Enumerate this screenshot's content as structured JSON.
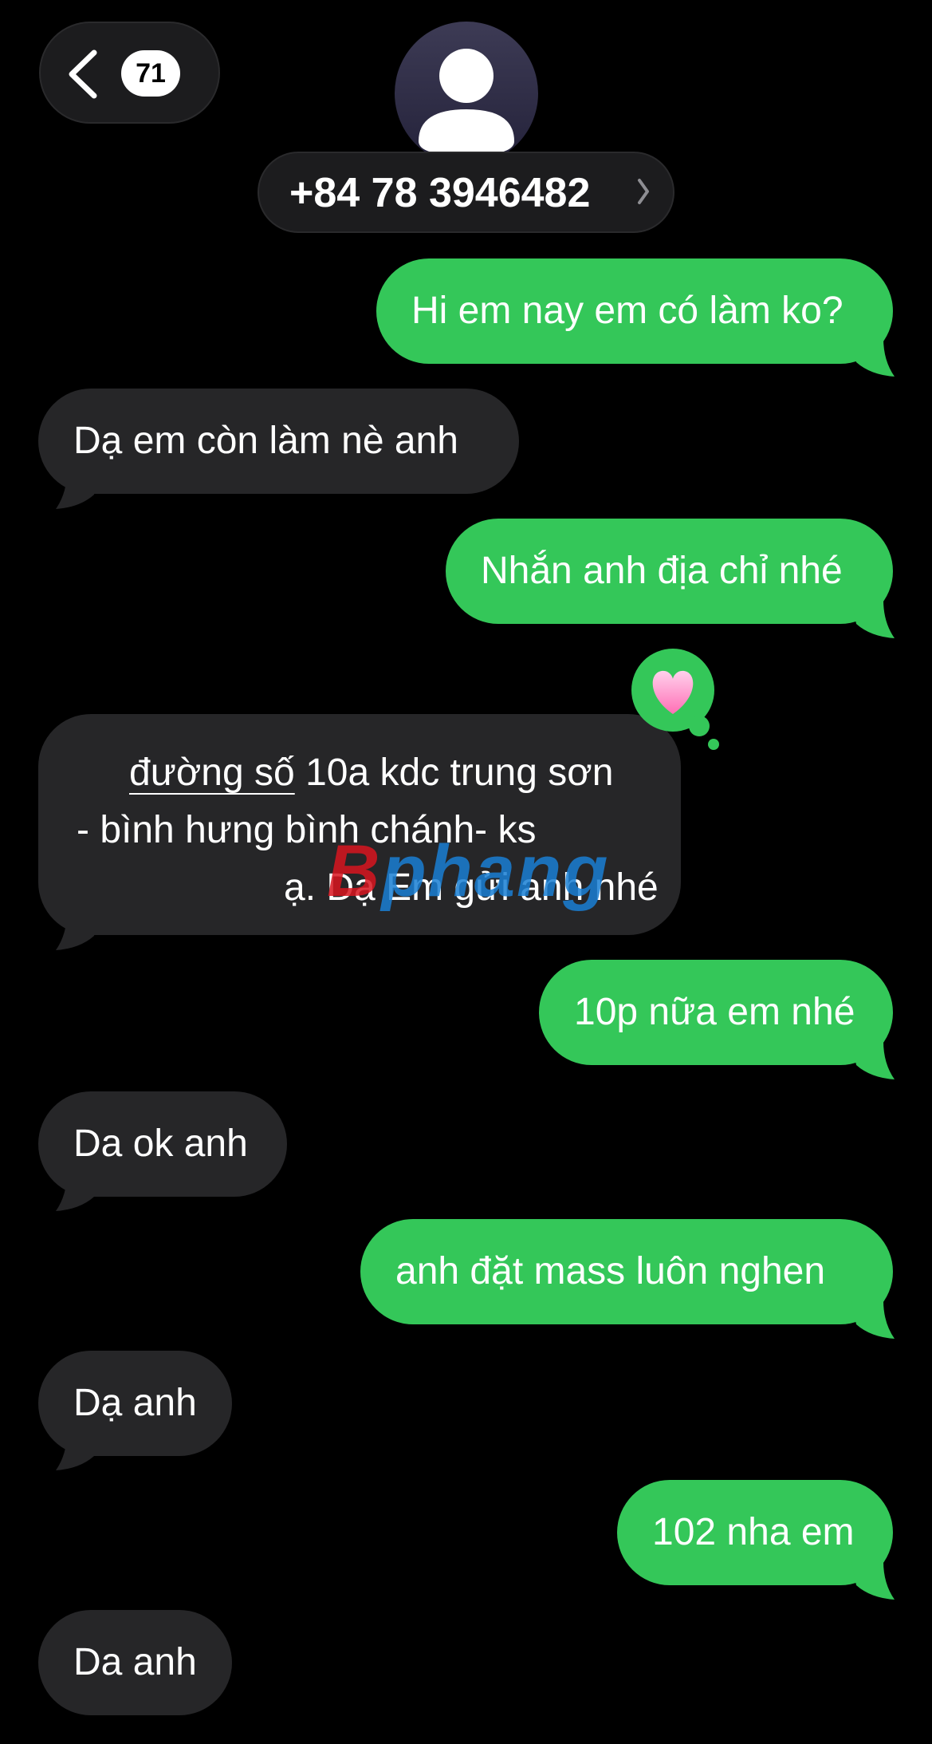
{
  "header": {
    "unread_count": "71",
    "contact": "+84 78 3946482",
    "contact_chevron": "›"
  },
  "messages": [
    {
      "side": "outgoing",
      "text": "Hi em nay em có làm ko?"
    },
    {
      "side": "incoming",
      "text": "Dạ em còn làm nè anh"
    },
    {
      "side": "outgoing",
      "text": "Nhắn anh địa chỉ nhé"
    },
    {
      "side": "incoming",
      "lines": [
        "đường số 10a kdc trung sơn",
        "- bình hưng bình chánh- ks",
        "ạ. Dạ Em gửi anh nhé"
      ],
      "link_text": "đường số",
      "reaction": "💗"
    },
    {
      "side": "outgoing",
      "text": "10p nữa em nhé"
    },
    {
      "side": "incoming",
      "text": "Da ok anh"
    },
    {
      "side": "outgoing",
      "text": "anh đặt mass luôn nghen"
    },
    {
      "side": "incoming",
      "text": "Dạ anh"
    },
    {
      "side": "outgoing",
      "text": "102 nha em"
    },
    {
      "side": "incoming",
      "text": "Da anh"
    }
  ],
  "watermark": {
    "part1": "B",
    "part2": "phang"
  },
  "colors": {
    "outgoing": "#34c759",
    "incoming": "#262628",
    "background": "#000000"
  }
}
